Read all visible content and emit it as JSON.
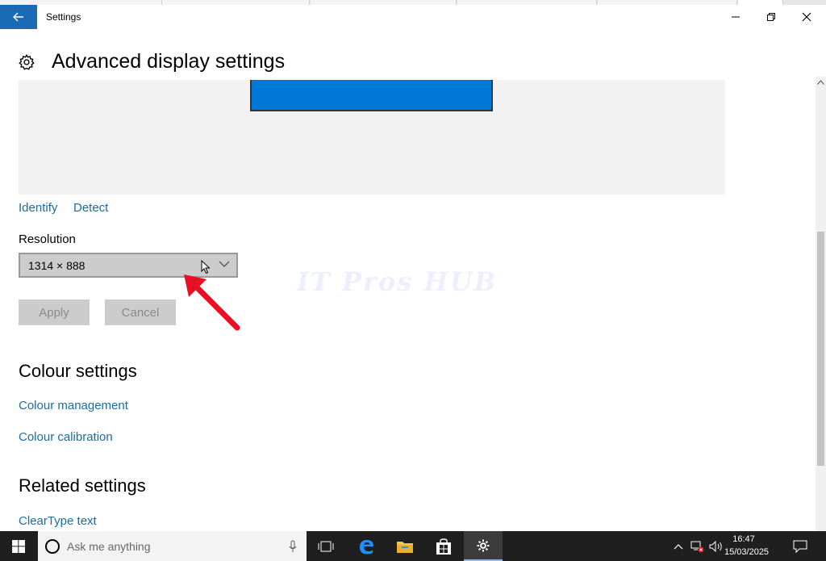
{
  "window": {
    "title": "Settings"
  },
  "header": {
    "title": "Advanced display settings",
    "icon": "gear-icon"
  },
  "display_links": {
    "identify": "Identify",
    "detect": "Detect"
  },
  "resolution": {
    "label": "Resolution",
    "value": "1314 × 888"
  },
  "buttons": {
    "apply": "Apply",
    "cancel": "Cancel"
  },
  "colour_section": {
    "title": "Colour settings",
    "links": [
      "Colour management",
      "Colour calibration"
    ]
  },
  "related_section": {
    "title": "Related settings",
    "links": [
      "ClearType text"
    ]
  },
  "watermark": "IT Pros HUB",
  "taskbar": {
    "search_placeholder": "Ask me anything",
    "time": "16:47",
    "date": "15/03/2025"
  },
  "colors": {
    "accent": "#1a6bb3",
    "monitor": "#0078d7",
    "link": "#1a6ba3",
    "annotation_arrow": "#e81123"
  }
}
